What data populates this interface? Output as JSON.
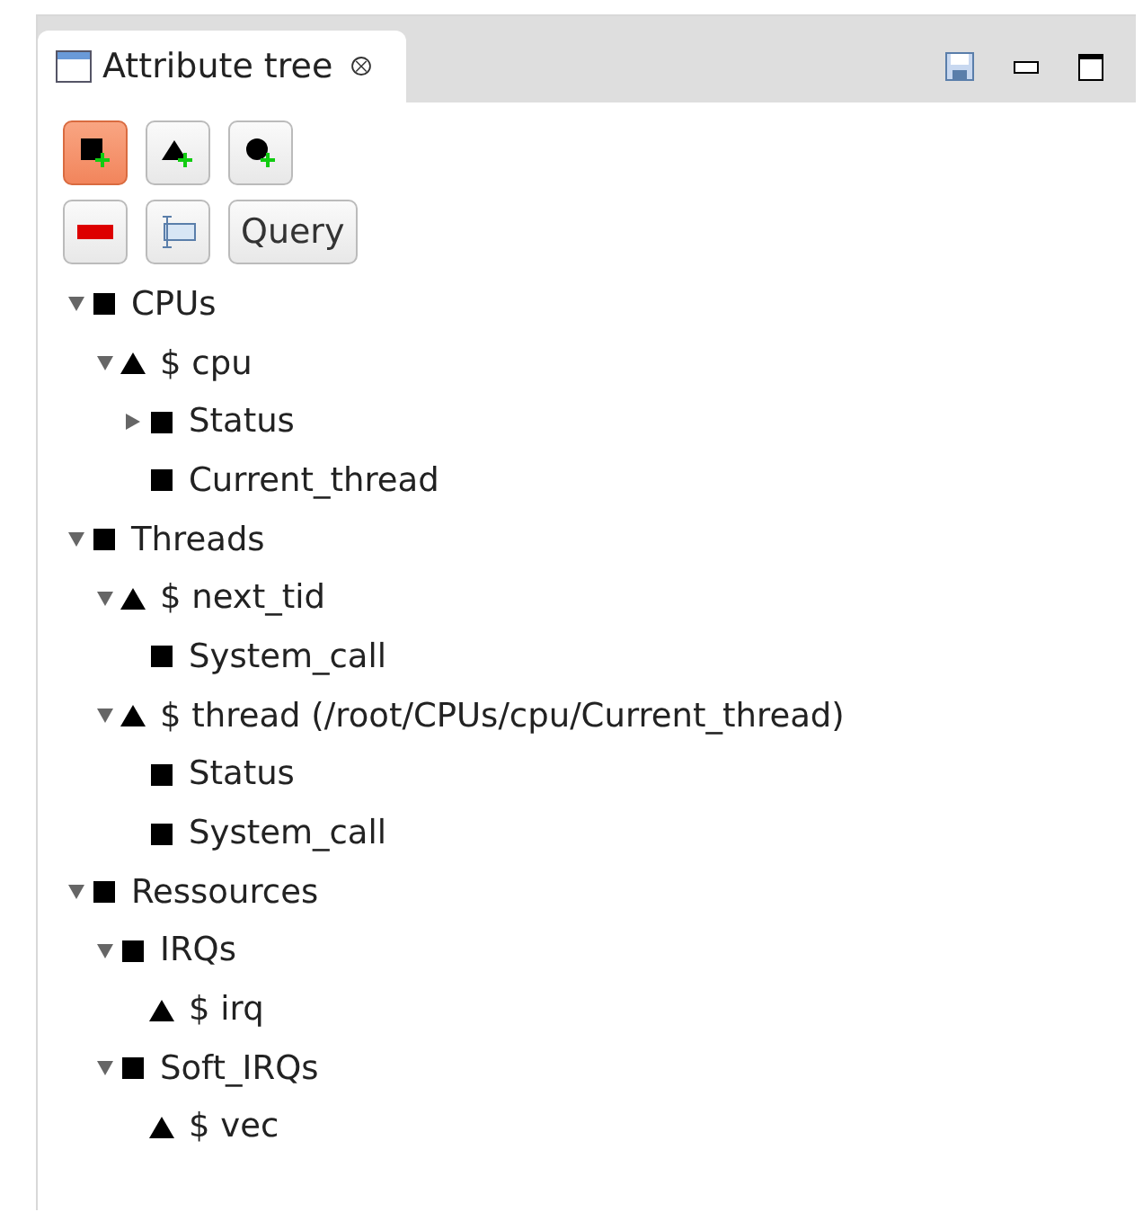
{
  "view": {
    "title": "Attribute tree",
    "close": "⮾"
  },
  "toolbar": [
    {
      "kind": "square-add",
      "selected": true
    },
    {
      "kind": "triangle-add",
      "selected": false
    },
    {
      "kind": "circle-add",
      "selected": false
    },
    {
      "kind": "remove",
      "selected": false
    },
    {
      "kind": "rename",
      "selected": false
    },
    {
      "kind": "text",
      "label": "Query",
      "selected": false
    }
  ],
  "tree": [
    {
      "label": "CPUs",
      "kind": "square",
      "expanded": true,
      "children": [
        {
          "label": "$ cpu",
          "kind": "triangle",
          "expanded": true,
          "children": [
            {
              "label": "Status",
              "kind": "square",
              "expanded": false
            },
            {
              "label": "Current_thread",
              "kind": "square"
            }
          ]
        }
      ]
    },
    {
      "label": "Threads",
      "kind": "square",
      "expanded": true,
      "children": [
        {
          "label": "$ next_tid",
          "kind": "triangle",
          "expanded": true,
          "children": [
            {
              "label": "System_call",
              "kind": "square"
            }
          ]
        },
        {
          "label": "$ thread (/root/CPUs/cpu/Current_thread)",
          "kind": "triangle",
          "expanded": true,
          "children": [
            {
              "label": "Status",
              "kind": "square"
            },
            {
              "label": "System_call",
              "kind": "square"
            }
          ]
        }
      ]
    },
    {
      "label": "Ressources",
      "kind": "square",
      "expanded": true,
      "children": [
        {
          "label": "IRQs",
          "kind": "square",
          "expanded": true,
          "children": [
            {
              "label": "$ irq",
              "kind": "triangle"
            }
          ]
        },
        {
          "label": "Soft_IRQs",
          "kind": "square",
          "expanded": true,
          "children": [
            {
              "label": "$ vec",
              "kind": "triangle"
            }
          ]
        }
      ]
    }
  ]
}
